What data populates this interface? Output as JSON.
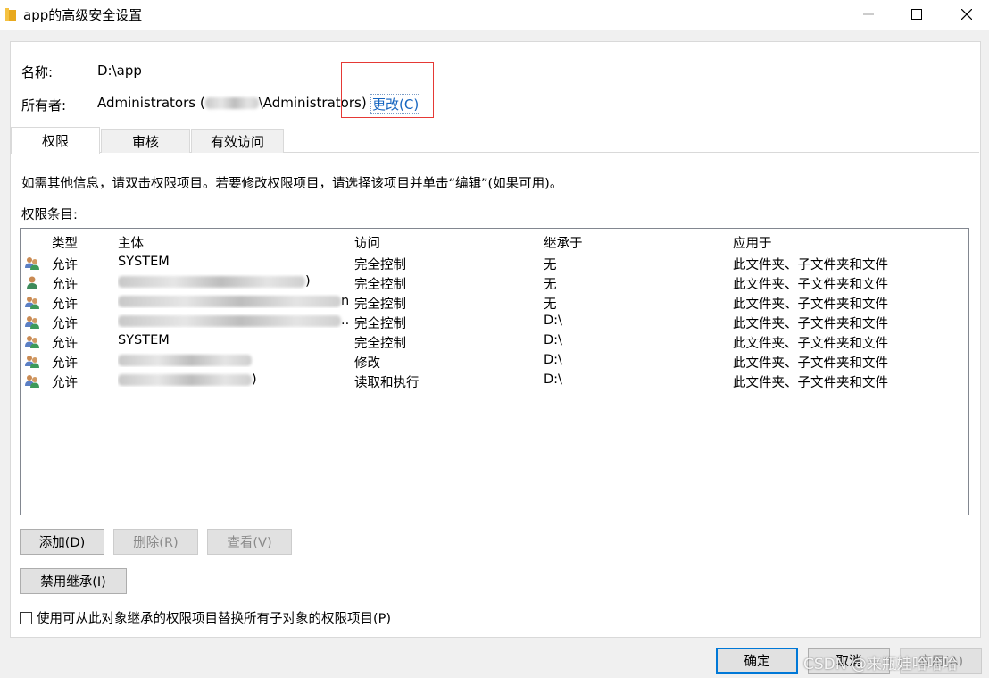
{
  "window": {
    "title": "app的高级安全设置",
    "minimize_glyph": "—",
    "maximize_glyph": "☐",
    "close_glyph": "✕"
  },
  "info": {
    "name_label": "名称:",
    "name_value": "D:\\app",
    "owner_label": "所有者:",
    "owner_prefix": "Administrators (",
    "owner_suffix": "\\Administrators)",
    "change_link": "更改(C)"
  },
  "tabs": [
    {
      "label": "权限",
      "active": true
    },
    {
      "label": "审核",
      "active": false
    },
    {
      "label": "有效访问",
      "active": false
    }
  ],
  "description": "如需其他信息，请双击权限项目。若要修改权限项目，请选择该项目并单击“编辑”(如果可用)。",
  "entries_label": "权限条目:",
  "columns": [
    "类型",
    "主体",
    "访问",
    "继承于",
    "应用于"
  ],
  "rows": [
    {
      "type": "允许",
      "principal": "SYSTEM",
      "principal_suffix": "",
      "access": "完全控制",
      "inherited": "无",
      "applies": "此文件夹、子文件夹和文件",
      "icon": "group-user-icon"
    },
    {
      "type": "允许",
      "principal": "",
      "principal_suffix": ")",
      "access": "完全控制",
      "inherited": "无",
      "applies": "此文件夹、子文件夹和文件",
      "icon": "single-user-icon"
    },
    {
      "type": "允许",
      "principal": "",
      "principal_suffix": "nist...",
      "access": "完全控制",
      "inherited": "无",
      "applies": "此文件夹、子文件夹和文件",
      "icon": "group-user-icon"
    },
    {
      "type": "允许",
      "principal": "",
      "principal_suffix": "...",
      "access": "完全控制",
      "inherited": "D:\\",
      "applies": "此文件夹、子文件夹和文件",
      "icon": "group-user-icon"
    },
    {
      "type": "允许",
      "principal": "SYSTEM",
      "principal_suffix": "",
      "access": "完全控制",
      "inherited": "D:\\",
      "applies": "此文件夹、子文件夹和文件",
      "icon": "group-user-icon"
    },
    {
      "type": "允许",
      "principal": "",
      "principal_suffix": "",
      "access": "修改",
      "inherited": "D:\\",
      "applies": "此文件夹、子文件夹和文件",
      "icon": "group-user-icon"
    },
    {
      "type": "允许",
      "principal": "",
      "principal_suffix": ")",
      "access": "读取和执行",
      "inherited": "D:\\",
      "applies": "此文件夹、子文件夹和文件",
      "icon": "group-user-icon"
    }
  ],
  "buttons": {
    "add": "添加(D)",
    "remove": "删除(R)",
    "view": "查看(V)",
    "disable_inheritance": "禁用继承(I)",
    "replace_checkbox": "使用可从此对象继承的权限项目替换所有子对象的权限项目(P)",
    "ok": "确定",
    "cancel": "取消",
    "apply": "应用(A)"
  },
  "watermark": "CSDN @来瓶娃哈哈哈"
}
